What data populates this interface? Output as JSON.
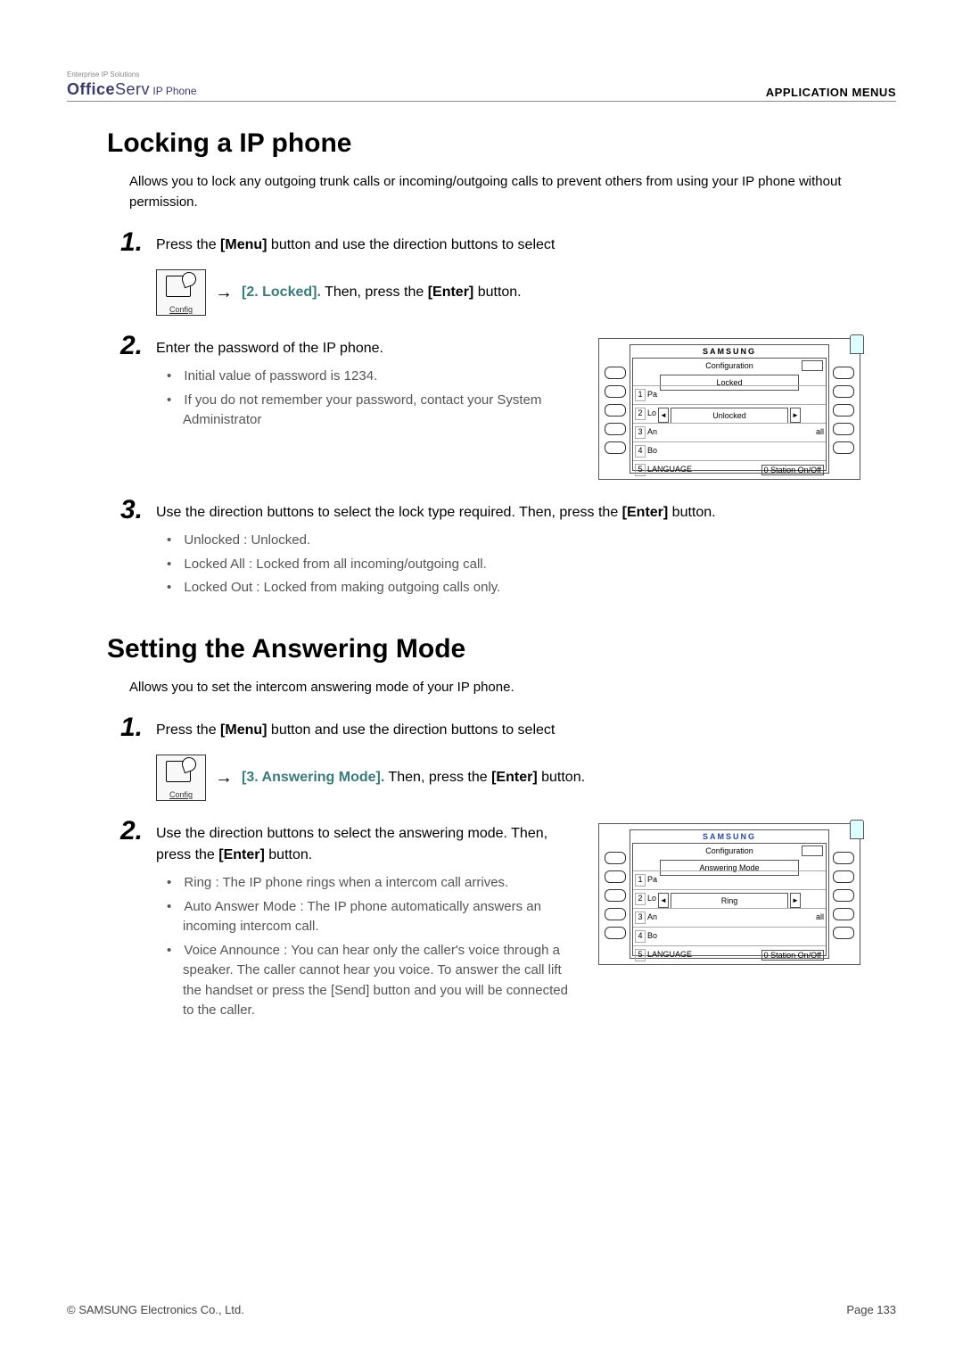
{
  "header": {
    "brand_tagline": "Enterprise IP Solutions",
    "brand_office": "Office",
    "brand_serv": "Serv",
    "brand_ip": " IP Phone",
    "section_label": "APPLICATION MENUS"
  },
  "section1": {
    "title": "Locking a IP phone",
    "intro": "Allows you to lock any outgoing trunk calls or incoming/outgoing calls to prevent others from using your IP phone without permission.",
    "step1": {
      "num": "1.",
      "text_a": "Press the ",
      "menu": "[Menu]",
      "text_b": " button and use the direction buttons to select",
      "config_label": "Config",
      "arrow": "→",
      "highlight": "[2. Locked].",
      "tail": "  Then, press the ",
      "enter": "[Enter]",
      "tail2": " button."
    },
    "step2": {
      "num": "2.",
      "text": "Enter the password of the IP phone.",
      "bullets": [
        "Initial value of password is 1234.",
        "If you do not remember your password, contact your System Administrator"
      ]
    },
    "screen1": {
      "brand": "SAMSUNG",
      "heading": "Configuration",
      "box1": "Locked",
      "box2": "Unlocked",
      "rows": [
        {
          "n": "1",
          "l": "Pa",
          "r": ""
        },
        {
          "n": "2",
          "l": "Lo",
          "r": ""
        },
        {
          "n": "3",
          "l": "An",
          "r": "all"
        },
        {
          "n": "4",
          "l": "Bo",
          "r": ""
        },
        {
          "n": "5",
          "l": "LANGUAGE",
          "r": "0  Station On/Off"
        }
      ]
    },
    "step3": {
      "num": "3.",
      "text_a": "Use the direction buttons to select the lock type required. Then, press the ",
      "enter": "[Enter]",
      "text_b": " button.",
      "bullets": [
        "Unlocked : Unlocked.",
        "Locked All : Locked from all incoming/outgoing call.",
        "Locked Out : Locked from making outgoing calls only."
      ]
    }
  },
  "section2": {
    "title": "Setting the Answering Mode",
    "intro": "Allows you to set the intercom answering mode of your IP phone.",
    "step1": {
      "num": "1.",
      "text_a": "Press the ",
      "menu": "[Menu]",
      "text_b": " button and use the direction buttons to select",
      "config_label": "Config",
      "arrow": "→",
      "highlight": "[3. Answering Mode].",
      "tail": "  Then, press the ",
      "enter": "[Enter]",
      "tail2": " button."
    },
    "step2": {
      "num": "2.",
      "text_a": "Use the direction buttons to select the answering mode. Then, press the ",
      "enter": "[Enter]",
      "text_b": " button.",
      "bullets": [
        "Ring : The IP phone rings when a intercom call arrives.",
        "Auto Answer Mode : The IP phone automatically answers an incoming intercom call.",
        "Voice Announce : You can hear only the caller's voice through a speaker. The caller cannot hear you voice. To answer the call lift the handset or press the [Send] button and you will be connected to the caller."
      ]
    },
    "screen2": {
      "brand": "SAMSUNG",
      "heading": "Configuration",
      "box1": "Answering Mode",
      "box2": "Ring",
      "rows": [
        {
          "n": "1",
          "l": "Pa",
          "r": ""
        },
        {
          "n": "2",
          "l": "Lo",
          "r": ""
        },
        {
          "n": "3",
          "l": "An",
          "r": "all"
        },
        {
          "n": "4",
          "l": "Bo",
          "r": ""
        },
        {
          "n": "5",
          "l": "LANGUAGE",
          "r": "0  Station On/Off"
        }
      ]
    }
  },
  "footer": {
    "copyright": "© SAMSUNG Electronics Co., Ltd.",
    "page": "Page 133"
  }
}
